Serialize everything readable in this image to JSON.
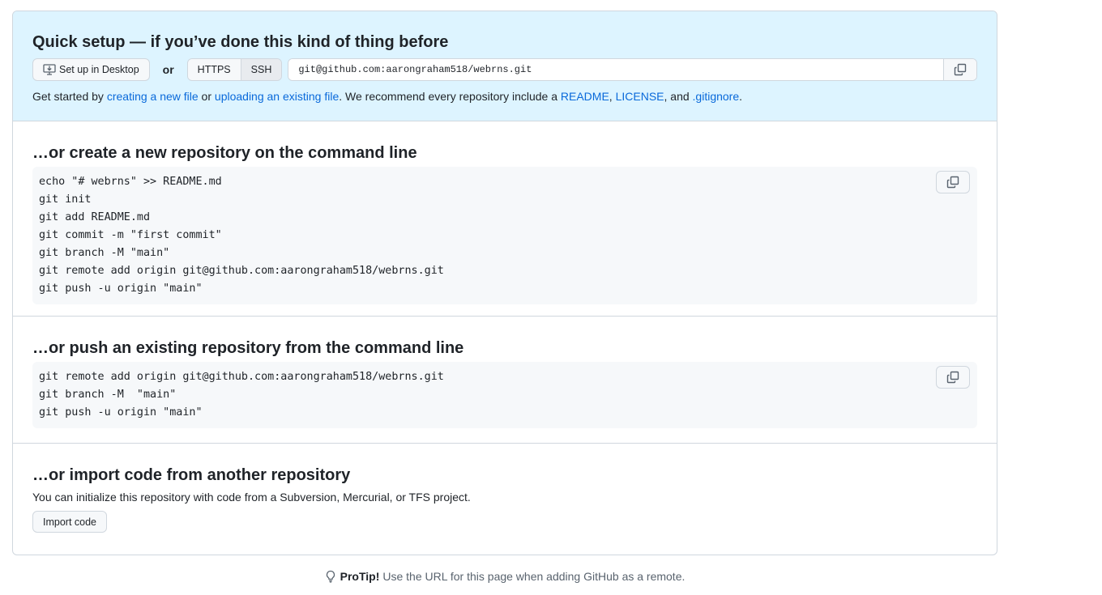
{
  "quick": {
    "title": "Quick setup — if you’ve done this kind of thing before",
    "desktop_btn": "Set up in Desktop",
    "or": "or",
    "https": "HTTPS",
    "ssh": "SSH",
    "url": "git@github.com:aarongraham518/webrns.git",
    "help": {
      "t1": "Get started by ",
      "l1": "creating a new file",
      "t2": " or ",
      "l2": "uploading an existing file",
      "t3": ". We recommend every repository include a ",
      "l3": "README",
      "t4": ", ",
      "l4": "LICENSE",
      "t5": ", and ",
      "l5": ".gitignore",
      "t6": "."
    }
  },
  "create": {
    "title": "…or create a new repository on the command line",
    "code": "echo \"# webrns\" >> README.md\ngit init\ngit add README.md\ngit commit -m \"first commit\"\ngit branch -M \"main\"\ngit remote add origin git@github.com:aarongraham518/webrns.git\ngit push -u origin \"main\""
  },
  "push": {
    "title": "…or push an existing repository from the command line",
    "code": "git remote add origin git@github.com:aarongraham518/webrns.git\ngit branch -M  \"main\"\ngit push -u origin \"main\""
  },
  "import": {
    "title": "…or import code from another repository",
    "text": "You can initialize this repository with code from a Subversion, Mercurial, or TFS project.",
    "button": "Import code"
  },
  "protip": {
    "label": "ProTip!",
    "text": "Use the URL for this page when adding GitHub as a remote."
  }
}
